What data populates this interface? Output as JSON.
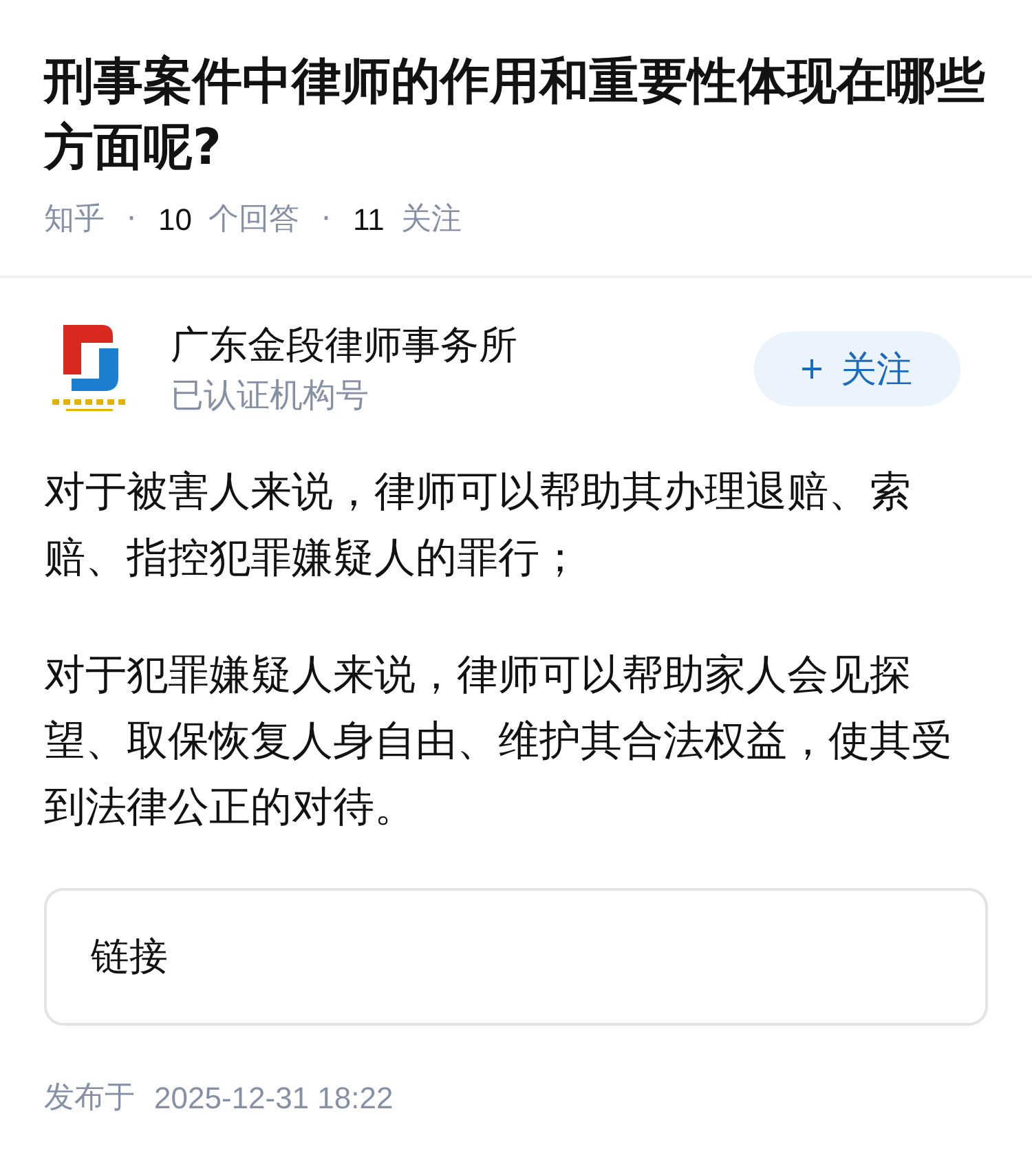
{
  "question": {
    "title": "刑事案件中律师的作用和重要性体现在哪些方面呢?",
    "meta": [
      {
        "kind": "source",
        "text": "知乎"
      },
      {
        "kind": "separator",
        "text": "·"
      },
      {
        "kind": "number",
        "text": "10"
      },
      {
        "kind": "label",
        "text": "个回答"
      },
      {
        "kind": "separator",
        "text": "·"
      },
      {
        "kind": "number",
        "text": "11"
      },
      {
        "kind": "label",
        "text": "关注"
      }
    ]
  },
  "author": {
    "name": "广东金段律师事务所",
    "badge": "已认证机构号",
    "follow_button": {
      "label": "关注"
    }
  },
  "answer": {
    "paragraphs": [
      "对于被害人来说，律师可以帮助其办理退赔、索赔、指控犯罪嫌疑人的罪行；",
      "对于犯罪嫌疑人来说，律师可以帮助家人会见探望、取保恢复人身自由、维护其合法权益，使其受到法律公正的对待。"
    ],
    "link_card": {
      "label": "链接"
    }
  },
  "footer": {
    "prefix": "发布于",
    "time": "2025-12-31 18:22"
  }
}
